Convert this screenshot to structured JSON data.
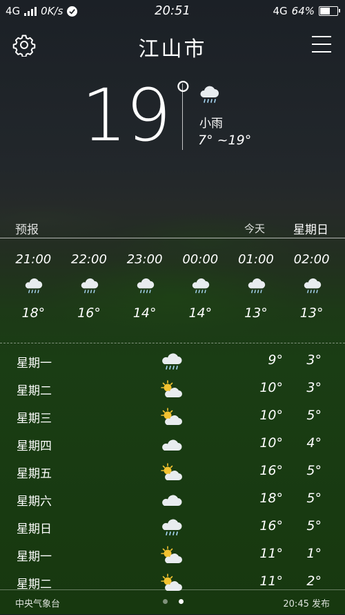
{
  "statusbar": {
    "network_left": "4G",
    "speed": "0K/s",
    "time": "20:51",
    "network_right": "4G",
    "battery": "64%",
    "battery_level": 0.64
  },
  "header": {
    "city": "江山市"
  },
  "current": {
    "temp": "19",
    "deg": "°",
    "condition": "小雨",
    "range": "7°  ~19°",
    "icon": "light-rain-icon"
  },
  "forecast": {
    "label": "预报",
    "today": "今天",
    "day": "星期日"
  },
  "hourly": [
    {
      "time": "21:00",
      "icon": "rain-cloud-icon",
      "temp": "18°"
    },
    {
      "time": "22:00",
      "icon": "rain-cloud-icon",
      "temp": "16°"
    },
    {
      "time": "23:00",
      "icon": "rain-cloud-icon",
      "temp": "14°"
    },
    {
      "time": "00:00",
      "icon": "rain-cloud-icon",
      "temp": "14°"
    },
    {
      "time": "01:00",
      "icon": "rain-cloud-icon",
      "temp": "13°"
    },
    {
      "time": "02:00",
      "icon": "rain-cloud-icon",
      "temp": "13°"
    }
  ],
  "daily": [
    {
      "day": "星期一",
      "icon": "rain-cloud-icon",
      "high": "9°",
      "low": "3°"
    },
    {
      "day": "星期二",
      "icon": "partly-cloudy-icon",
      "high": "10°",
      "low": "3°"
    },
    {
      "day": "星期三",
      "icon": "partly-cloudy-icon",
      "high": "10°",
      "low": "5°"
    },
    {
      "day": "星期四",
      "icon": "cloud-icon",
      "high": "10°",
      "low": "4°"
    },
    {
      "day": "星期五",
      "icon": "partly-cloudy-icon",
      "high": "16°",
      "low": "5°"
    },
    {
      "day": "星期六",
      "icon": "cloud-icon",
      "high": "18°",
      "low": "5°"
    },
    {
      "day": "星期日",
      "icon": "rain-cloud-icon",
      "high": "16°",
      "low": "5°"
    },
    {
      "day": "星期一",
      "icon": "partly-cloudy-icon",
      "high": "11°",
      "low": "1°"
    },
    {
      "day": "星期二",
      "icon": "partly-cloudy-icon",
      "high": "11°",
      "low": "2°"
    }
  ],
  "footer": {
    "source": "中央气象台",
    "published": "20:45 发布",
    "page_count": 2,
    "active_page": 2
  },
  "colors": {
    "sun": "#f2c230",
    "cloud": "#e8ecef",
    "rain": "#a9d8f5"
  }
}
